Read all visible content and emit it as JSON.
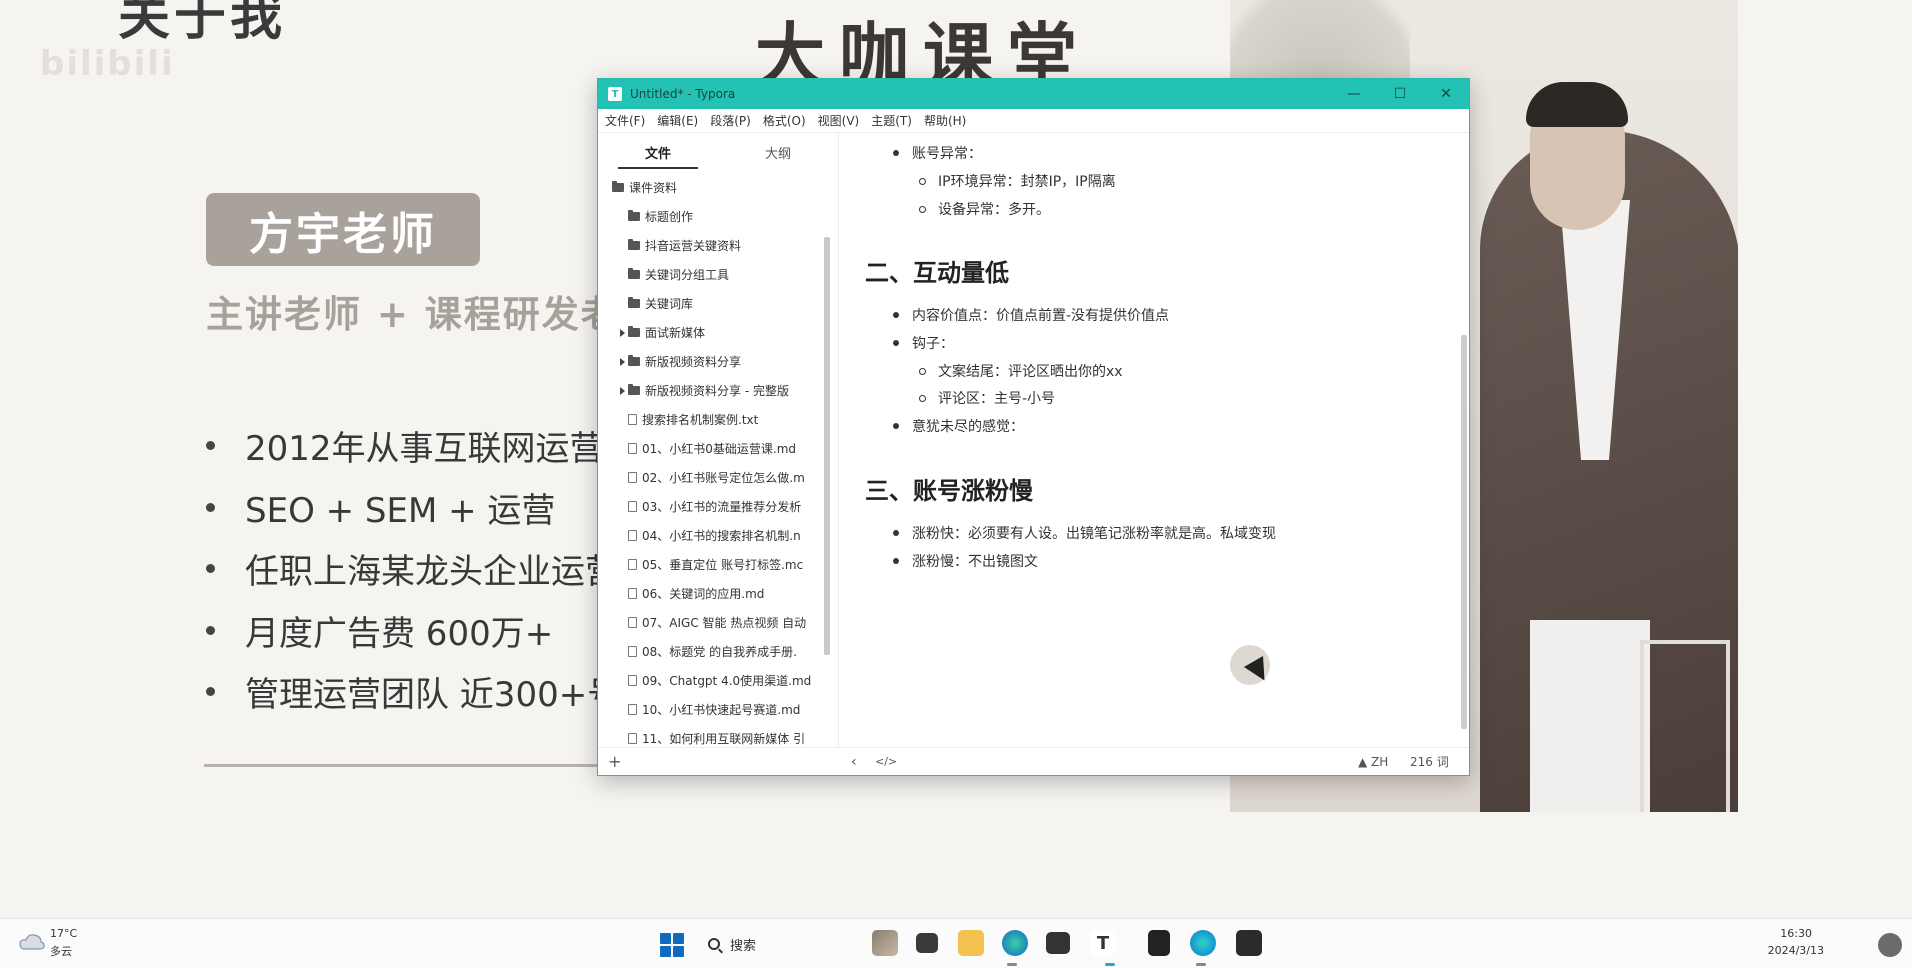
{
  "slide": {
    "heading": "关于我",
    "watermark": "bilibili",
    "brand": "大咖课堂",
    "teacher_name": "方宇老师",
    "subtitle": "主讲老师 + 课程研发老",
    "bullets": [
      "2012年从事互联网运营",
      "SEO + SEM + 运营",
      "任职上海某龙头企业运营",
      "月度广告费 600万+",
      "管理运营团队 近300+号"
    ]
  },
  "window": {
    "title": "Untitled* - Typora",
    "app_icon_letter": "T",
    "controls": {
      "minimize": "—",
      "maximize": "☐",
      "close": "✕"
    },
    "menu": [
      "文件(F)",
      "编辑(E)",
      "段落(P)",
      "格式(O)",
      "视图(V)",
      "主题(T)",
      "帮助(H)"
    ],
    "sidebar": {
      "tabs": [
        "文件",
        "大纲"
      ],
      "active_tab": "文件",
      "tree": [
        {
          "label": "课件资料",
          "type": "folder",
          "level": 0,
          "expanded": true
        },
        {
          "label": "标题创作",
          "type": "folder",
          "level": 1
        },
        {
          "label": "抖音运营关键资料",
          "type": "folder",
          "level": 1
        },
        {
          "label": "关键词分组工具",
          "type": "folder",
          "level": 1
        },
        {
          "label": "关键词库",
          "type": "folder",
          "level": 1
        },
        {
          "label": "面试新媒体",
          "type": "folder",
          "level": 1,
          "collapsible": true
        },
        {
          "label": "新版视频资料分享",
          "type": "folder",
          "level": 1,
          "collapsible": true
        },
        {
          "label": "新版视频资料分享 - 完整版",
          "type": "folder",
          "level": 1,
          "collapsible": true
        },
        {
          "label": "搜索排名机制案例.txt",
          "type": "file",
          "level": 1
        },
        {
          "label": "01、小红书0基础运营课.md",
          "type": "file",
          "level": 1
        },
        {
          "label": "02、小红书账号定位怎么做.m",
          "type": "file",
          "level": 1
        },
        {
          "label": "03、小红书的流量推荐分发析",
          "type": "file",
          "level": 1
        },
        {
          "label": "04、小红书的搜索排名机制.n",
          "type": "file",
          "level": 1
        },
        {
          "label": "05、垂直定位 账号打标签.mc",
          "type": "file",
          "level": 1
        },
        {
          "label": "06、关键词的应用.md",
          "type": "file",
          "level": 1
        },
        {
          "label": "07、AIGC 智能 热点视频 自动",
          "type": "file",
          "level": 1
        },
        {
          "label": "08、标题党 的自我养成手册.",
          "type": "file",
          "level": 1
        },
        {
          "label": "09、Chatgpt 4.0使用渠道.md",
          "type": "file",
          "level": 1
        },
        {
          "label": "10、小红书快速起号赛道.md",
          "type": "file",
          "level": 1
        },
        {
          "label": "11、如何利用互联网新媒体 引",
          "type": "file",
          "level": 1
        }
      ]
    },
    "editor": {
      "blocks": [
        {
          "kind": "li1",
          "text": "账号异常："
        },
        {
          "kind": "li2",
          "text": "IP环境异常：封禁IP，IP隔离"
        },
        {
          "kind": "li2",
          "text": "设备异常：多开。"
        },
        {
          "kind": "h2",
          "text": "二、互动量低"
        },
        {
          "kind": "li1",
          "text": "内容价值点：价值点前置-没有提供价值点"
        },
        {
          "kind": "li1",
          "text": "钩子："
        },
        {
          "kind": "li2",
          "text": "文案结尾：评论区晒出你的xx"
        },
        {
          "kind": "li2",
          "text": "评论区：主号-小号"
        },
        {
          "kind": "li1",
          "text": "意犹未尽的感觉："
        },
        {
          "kind": "h2",
          "text": "三、账号涨粉慢"
        },
        {
          "kind": "li1",
          "text": "涨粉快：必须要有人设。出镜笔记涨粉率就是高。私域变现"
        },
        {
          "kind": "li1",
          "text": "涨粉慢：不出镜图文"
        }
      ]
    },
    "status": {
      "add": "+",
      "back": "‹",
      "source": "</>",
      "lang": "▲ ZH",
      "words": "216 词"
    }
  },
  "taskbar": {
    "weather_temp": "17°C",
    "weather_desc": "多云",
    "search_label": "搜索",
    "time": "16:30",
    "date": "2024/3/13"
  }
}
